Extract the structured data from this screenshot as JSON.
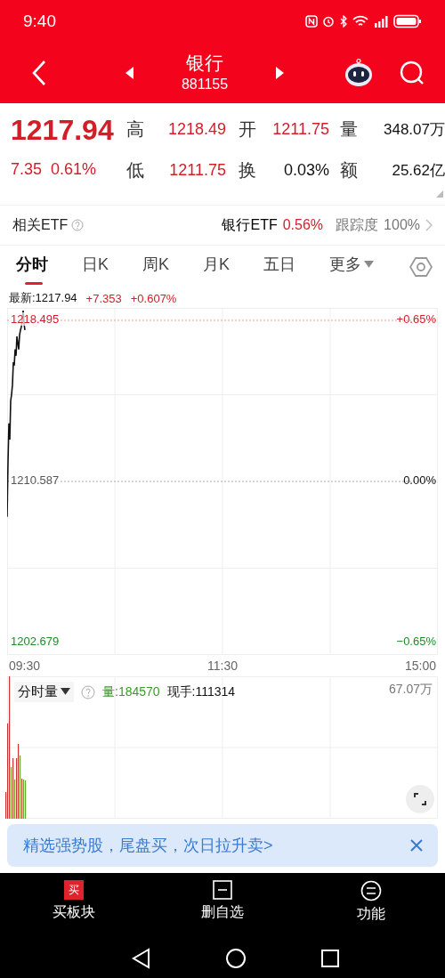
{
  "status_bar": {
    "time": "9:40"
  },
  "header": {
    "title": "银行",
    "code": "881155"
  },
  "quote": {
    "price": "1217.94",
    "change": "7.35",
    "change_pct": "0.61%",
    "fields": [
      {
        "label": "高",
        "value": "1218.49",
        "color": "#d21e28"
      },
      {
        "label": "开",
        "value": "1211.75",
        "color": "#d21e28"
      },
      {
        "label": "量",
        "value": "348.07万",
        "color": "#111111"
      },
      {
        "label": "低",
        "value": "1211.75",
        "color": "#d21e28"
      },
      {
        "label": "换",
        "value": "0.03%",
        "color": "#111111"
      },
      {
        "label": "额",
        "value": "25.62亿",
        "color": "#111111"
      }
    ]
  },
  "etf": {
    "label": "相关ETF",
    "name": "银行ETF",
    "change": "0.56%",
    "tracking_label": "跟踪度",
    "tracking_value": "100%"
  },
  "tabs": [
    {
      "label": "分时",
      "selected": true,
      "kind": "plain"
    },
    {
      "label": "日K",
      "selected": false,
      "kind": "plain"
    },
    {
      "label": "周K",
      "selected": false,
      "kind": "plain"
    },
    {
      "label": "月K",
      "selected": false,
      "kind": "plain"
    },
    {
      "label": "五日",
      "selected": false,
      "kind": "plain"
    },
    {
      "label": "更多",
      "selected": false,
      "kind": "dropdown"
    }
  ],
  "chart_info": {
    "latest": "最新:1217.94",
    "change": "+7.353",
    "change_pct": "+0.607%"
  },
  "price_chart": {
    "axis_labels": [
      {
        "label": "1218.495",
        "color": "#d21e28"
      },
      {
        "label": "1210.587",
        "color": "#555555"
      },
      {
        "label": "1202.679",
        "color": "#1f8a2a"
      }
    ],
    "right_labels": [
      {
        "label": "+0.65%",
        "color": "#d21e28"
      },
      {
        "label": "0.00%",
        "color": "#111111"
      },
      {
        "label": "−0.65%",
        "color": "#1f8a2a"
      }
    ],
    "time_labels": [
      "09:30",
      "11:30",
      "15:00"
    ]
  },
  "volume": {
    "indicator": "分时量",
    "volume": "量:184570",
    "current": "现手:111314",
    "max": "67.07万"
  },
  "banner": {
    "text": "精选强势股，尾盘买，次日拉升卖>"
  },
  "bottom_actions": [
    {
      "kind": "buy",
      "icon_text": "买",
      "label": "买板块"
    },
    {
      "kind": "remove",
      "label": "删自选"
    },
    {
      "kind": "menu",
      "label": "功能"
    }
  ]
}
